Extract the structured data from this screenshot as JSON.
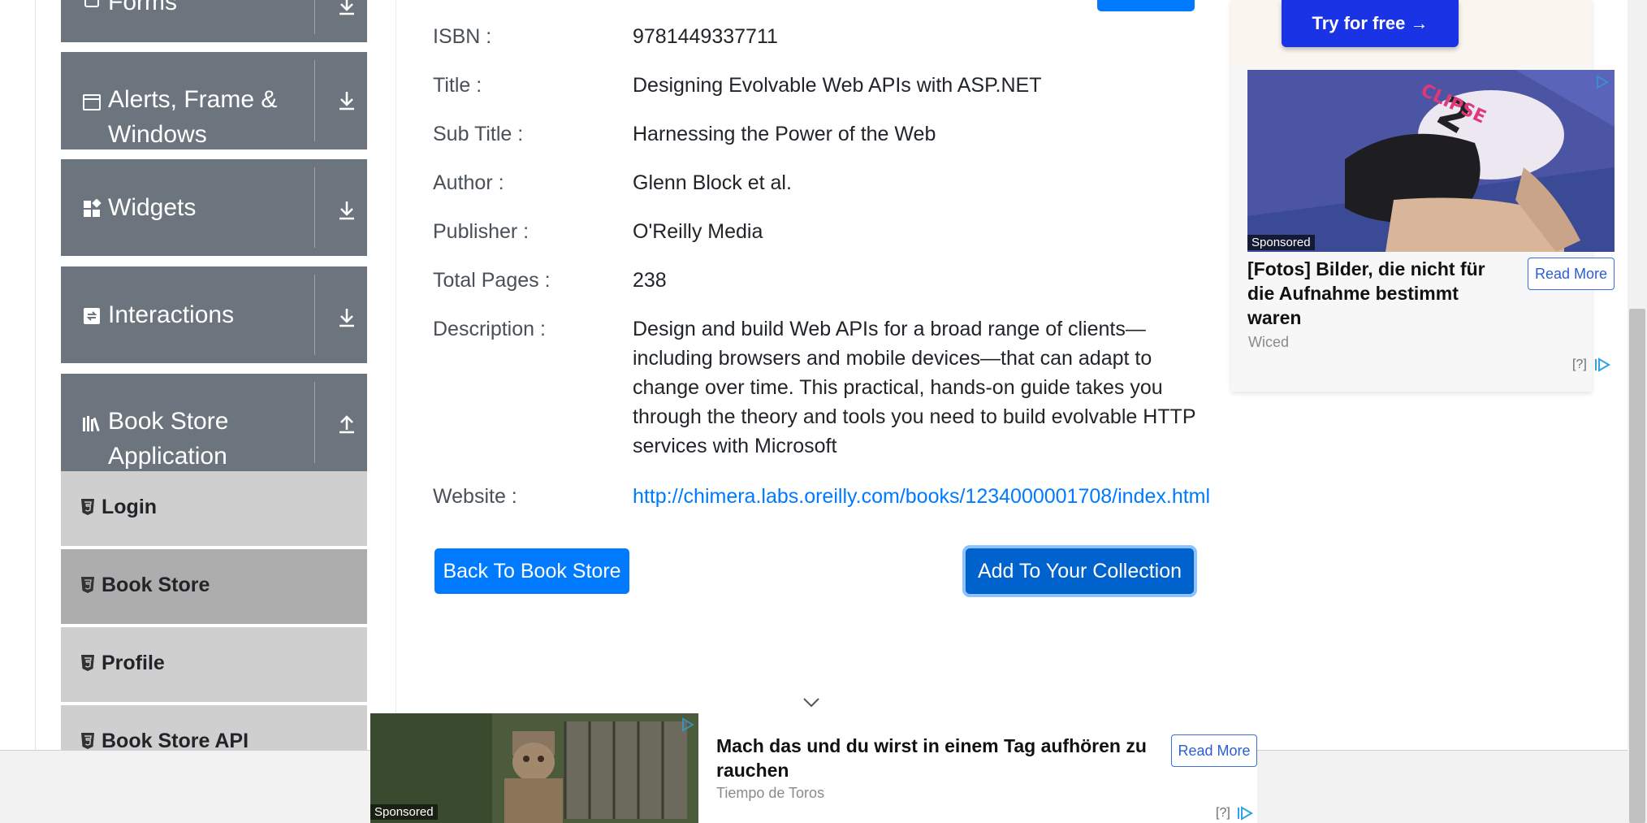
{
  "sidebar": {
    "groups": [
      {
        "label": "Forms",
        "icon": "form-icon",
        "arrow": "download-arrow-icon"
      },
      {
        "label": "Alerts, Frame & Windows",
        "icon": "window-icon",
        "arrow": "download-arrow-icon"
      },
      {
        "label": "Widgets",
        "icon": "widgets-icon",
        "arrow": "download-arrow-icon"
      },
      {
        "label": "Interactions",
        "icon": "interactions-icon",
        "arrow": "download-arrow-icon"
      },
      {
        "label": "Book Store Application",
        "icon": "books-icon",
        "arrow": "upload-arrow-icon"
      }
    ],
    "items": [
      {
        "label": "Login",
        "active": false
      },
      {
        "label": "Book Store",
        "active": true
      },
      {
        "label": "Profile",
        "active": false
      },
      {
        "label": "Book Store API",
        "active": false
      }
    ]
  },
  "book": {
    "isbn_label": "ISBN :",
    "isbn": "9781449337711",
    "title_label": "Title :",
    "title": "Designing Evolvable Web APIs with ASP.NET",
    "subtitle_label": "Sub Title :",
    "subtitle": "Harnessing the Power of the Web",
    "author_label": "Author :",
    "author": "Glenn Block et al.",
    "publisher_label": "Publisher :",
    "publisher": "O'Reilly Media",
    "pages_label": "Total Pages :",
    "pages": "238",
    "description_label": "Description :",
    "description": "Design and build Web APIs for a broad range of clients—including browsers and mobile devices—that can adapt to change over time. This practical, hands-on guide takes you through the theory and tools you need to build evolvable HTTP services with Microsoft",
    "website_label": "Website :",
    "website": "http://chimera.labs.oreilly.com/books/1234000001708/index.html"
  },
  "actions": {
    "back_label": "Back To Book Store",
    "add_label": "Add To Your Collection"
  },
  "ad_right": {
    "cta": "Try for free →",
    "sponsored": "Sponsored",
    "title": "[Fotos] Bilder, die nicht für die Aufnahme bestimmt waren",
    "source": "Wiced",
    "read_more": "Read More",
    "help": "[?]"
  },
  "ad_bottom": {
    "sponsored": "Sponsored",
    "title": "Mach das und du wirst in einem Tag aufhören zu rauchen",
    "source": "Tiempo de Toros",
    "read_more": "Read More",
    "help": "[?]"
  },
  "colors": {
    "primary": "#007bff",
    "sidebar_group": "#6c757d",
    "sidebar_item": "#cfcfcf",
    "sidebar_item_active": "#adadad"
  }
}
